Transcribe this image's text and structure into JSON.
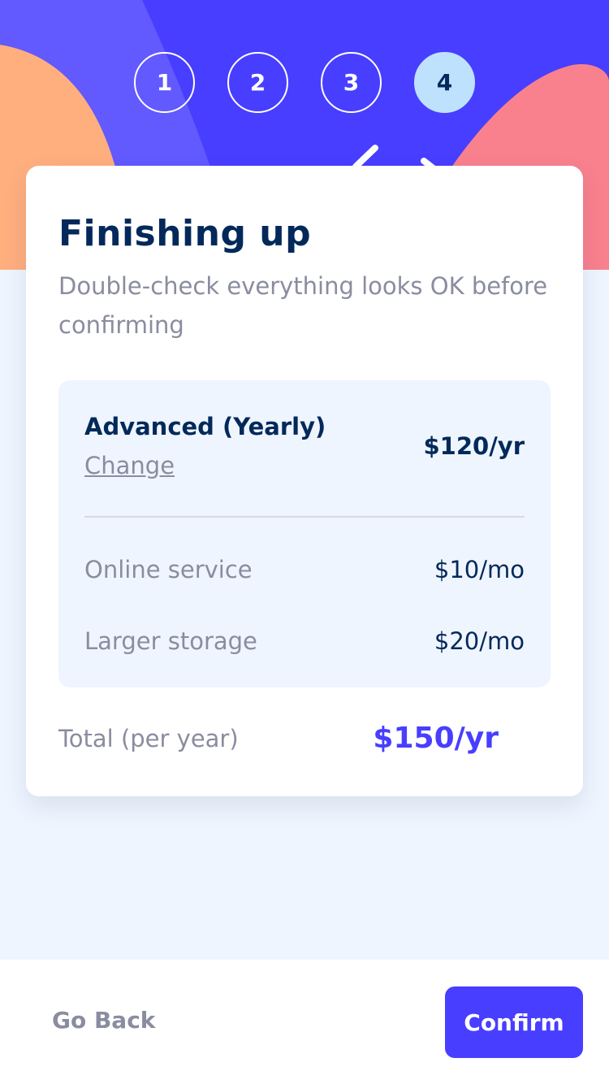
{
  "colors": {
    "header_bg": "#483eff",
    "blob_purple": "#6259ff",
    "blob_orange": "#ffaf7e",
    "blob_pink": "#f9818e",
    "marine_blue": "#02295a",
    "cool_gray": "#8a8ca0",
    "light_blue": "#bee2fd",
    "accent": "#483eff",
    "page_bg": "#eff5ff"
  },
  "steps": [
    {
      "label": "1",
      "active": false
    },
    {
      "label": "2",
      "active": false
    },
    {
      "label": "3",
      "active": false
    },
    {
      "label": "4",
      "active": true
    }
  ],
  "card": {
    "title": "Finishing up",
    "subtitle": "Double-check everything looks OK before confirming"
  },
  "summary": {
    "plan_name": "Advanced (Yearly)",
    "change_label": "Change",
    "plan_price": "$120/yr",
    "addons": [
      {
        "label": "Online service",
        "price": "$10/mo"
      },
      {
        "label": "Larger storage",
        "price": "$20/mo"
      }
    ]
  },
  "total": {
    "label": "Total (per year)",
    "price": "$150/yr"
  },
  "footer": {
    "back_label": "Go Back",
    "confirm_label": "Confirm"
  }
}
